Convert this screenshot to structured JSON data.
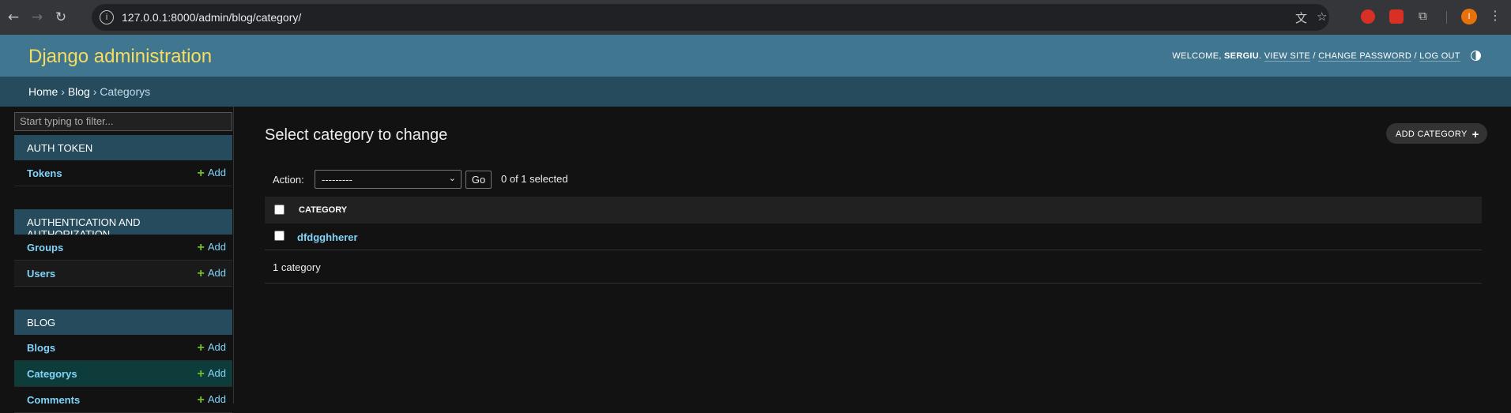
{
  "browser": {
    "url": "127.0.0.1:8000/admin/blog/category/",
    "profile_initial": "I"
  },
  "header": {
    "brand": "Django administration",
    "welcome": "Welcome,",
    "username": "sergiu",
    "view_site": "View site",
    "change_password": "Change password",
    "log_out": "Log out"
  },
  "breadcrumbs": {
    "home": "Home",
    "app": "Blog",
    "current": "Categorys",
    "separator": "›"
  },
  "sidebar": {
    "filter_placeholder": "Start typing to filter...",
    "add_label": "Add",
    "modules": [
      {
        "caption": "Auth Token",
        "items": [
          {
            "name": "Tokens"
          }
        ]
      },
      {
        "caption": "Authentication and Authorization",
        "items": [
          {
            "name": "Groups"
          },
          {
            "name": "Users"
          }
        ]
      },
      {
        "caption": "Blog",
        "items": [
          {
            "name": "Blogs"
          },
          {
            "name": "Categorys",
            "current": true
          },
          {
            "name": "Comments"
          }
        ]
      }
    ]
  },
  "main": {
    "title": "Select category to change",
    "add_button": "Add Category",
    "action_label": "Action:",
    "action_selected": "---------",
    "go_label": "Go",
    "selection_counter": "0 of 1 selected",
    "column_header": "Category",
    "rows": [
      "dfdgghherer"
    ],
    "paginator": "1 category"
  },
  "colors": {
    "header_bg": "#417690",
    "brand_text": "#f5dd5d",
    "breadcrumbs_bg": "#264b5d",
    "link": "#81d4fa",
    "add_plus": "#70bf2b",
    "current_row_bg": "#0d3c3a"
  }
}
